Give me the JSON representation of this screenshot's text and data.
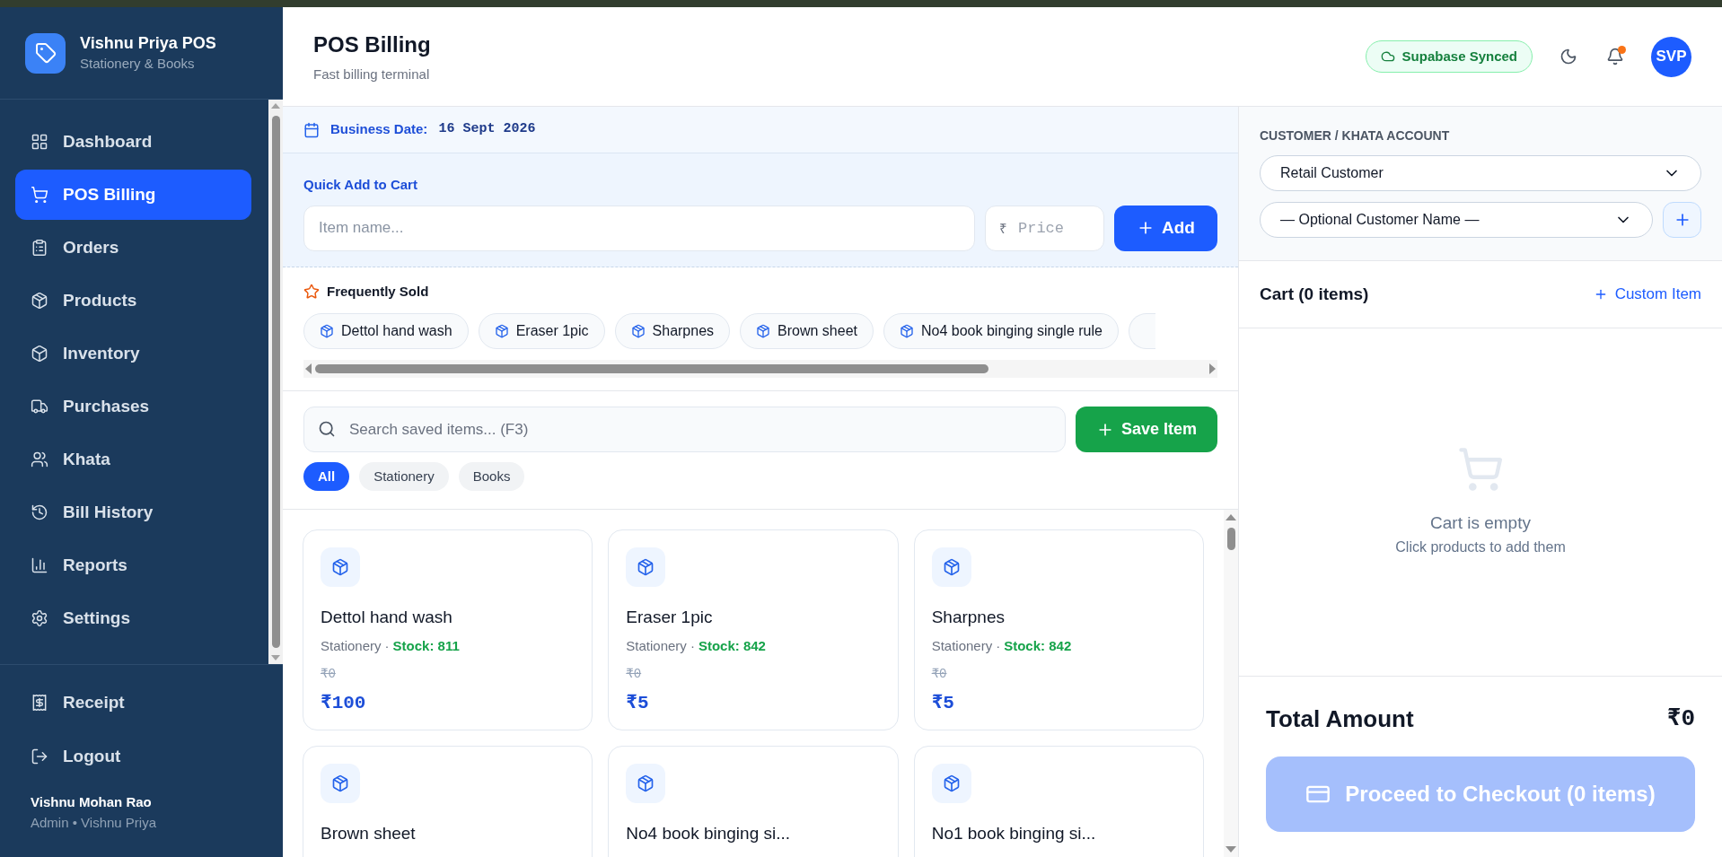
{
  "sidebar": {
    "brand": {
      "title": "Vishnu Priya POS",
      "subtitle": "Stationery & Books"
    },
    "items": [
      {
        "label": "Dashboard",
        "selected": false
      },
      {
        "label": "POS Billing",
        "selected": true
      },
      {
        "label": "Orders",
        "selected": false
      },
      {
        "label": "Products",
        "selected": false
      },
      {
        "label": "Inventory",
        "selected": false
      },
      {
        "label": "Purchases",
        "selected": false
      },
      {
        "label": "Khata",
        "selected": false
      },
      {
        "label": "Bill History",
        "selected": false
      },
      {
        "label": "Reports",
        "selected": false
      },
      {
        "label": "Settings",
        "selected": false
      }
    ],
    "footer_items": [
      {
        "label": "Receipt"
      },
      {
        "label": "Logout"
      }
    ],
    "user": {
      "name": "Vishnu Mohan Rao",
      "role": "Admin • Vishnu Priya"
    }
  },
  "header": {
    "title": "POS Billing",
    "subtitle": "Fast billing terminal",
    "sync_badge": "Supabase Synced",
    "notification": true,
    "avatar": "SVP"
  },
  "business_date": {
    "label": "Business Date:",
    "value": "16 Sept 2026"
  },
  "quick_add": {
    "title": "Quick Add to Cart",
    "item_placeholder": "Item name...",
    "currency": "₹",
    "price_placeholder": "Price",
    "button": "Add"
  },
  "frequently_sold": {
    "title": "Frequently Sold",
    "chips": [
      {
        "label": "Dettol hand wash"
      },
      {
        "label": "Eraser 1pic"
      },
      {
        "label": "Sharpnes"
      },
      {
        "label": "Brown sheet"
      },
      {
        "label": "No4 book binging single rule"
      }
    ]
  },
  "search": {
    "placeholder": "Search saved items... (F3)",
    "save_button": "Save Item"
  },
  "filters": [
    {
      "label": "All",
      "selected": true
    },
    {
      "label": "Stationery",
      "selected": false
    },
    {
      "label": "Books",
      "selected": false
    }
  ],
  "products": [
    {
      "name": "Dettol hand wash",
      "category": "Stationery",
      "separator": "·",
      "stock": "Stock: 811",
      "old_price": "₹0",
      "price": "₹100"
    },
    {
      "name": "Eraser 1pic",
      "category": "Stationery",
      "separator": "·",
      "stock": "Stock: 842",
      "old_price": "₹0",
      "price": "₹5"
    },
    {
      "name": "Sharpnes",
      "category": "Stationery",
      "separator": "·",
      "stock": "Stock: 842",
      "old_price": "₹0",
      "price": "₹5"
    },
    {
      "name": "Brown sheet"
    },
    {
      "name": "No4 book binging si..."
    },
    {
      "name": "No1 book binging si..."
    }
  ],
  "customer": {
    "title": "CUSTOMER / KHATA ACCOUNT",
    "account": "Retail Customer",
    "customer_name": "— Optional Customer Name —"
  },
  "cart": {
    "title": "Cart (0 items)",
    "custom_item": "Custom Item",
    "empty_title": "Cart is empty",
    "empty_hint": "Click products to add them"
  },
  "total": {
    "label": "Total Amount",
    "value": "₹0",
    "checkout": "Proceed to Checkout (0 items)",
    "disabled": true
  }
}
